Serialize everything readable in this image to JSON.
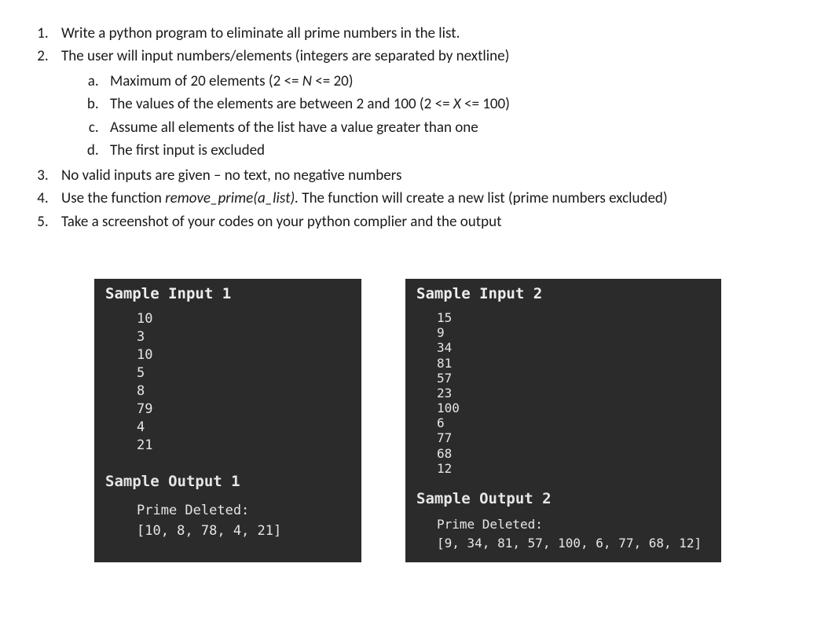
{
  "instructions": {
    "i1": "Write a python program to eliminate all prime numbers in the list.",
    "i2": "The user will input numbers/elements (integers are separated by nextline)",
    "i2a": "Maximum of 20 elements (2 <= N <= 20)",
    "i2b": "The values of the elements are between 2 and 100 (2 <= X <= 100)",
    "i2c": "Assume all elements of the list have a value greater than one",
    "i2d": "The first input is excluded",
    "i3": "No valid inputs are given – no text, no negative numbers",
    "i4_pre": "Use the function ",
    "i4_fn": "remove_prime(a_list).",
    "i4_post": " The function will create a new list (prime numbers excluded)",
    "i5": "Take a screenshot of your codes on your python complier and the output"
  },
  "sample1": {
    "title_in": "Sample Input 1",
    "input": [
      "10",
      "3",
      "10",
      "5",
      "8",
      "79",
      "4",
      "21"
    ],
    "title_out": "Sample Output 1",
    "out_label": "Prime Deleted:",
    "out_list": "[10, 8, 78, 4, 21]"
  },
  "sample2": {
    "title_in": "Sample Input 2",
    "input": [
      "15",
      "9",
      "34",
      "81",
      "57",
      "23",
      "100",
      "6",
      "77",
      "68",
      "12"
    ],
    "title_out": "Sample Output 2",
    "out_label": "Prime Deleted:",
    "out_list": "[9, 34, 81, 57, 100, 6, 77, 68, 12]"
  }
}
